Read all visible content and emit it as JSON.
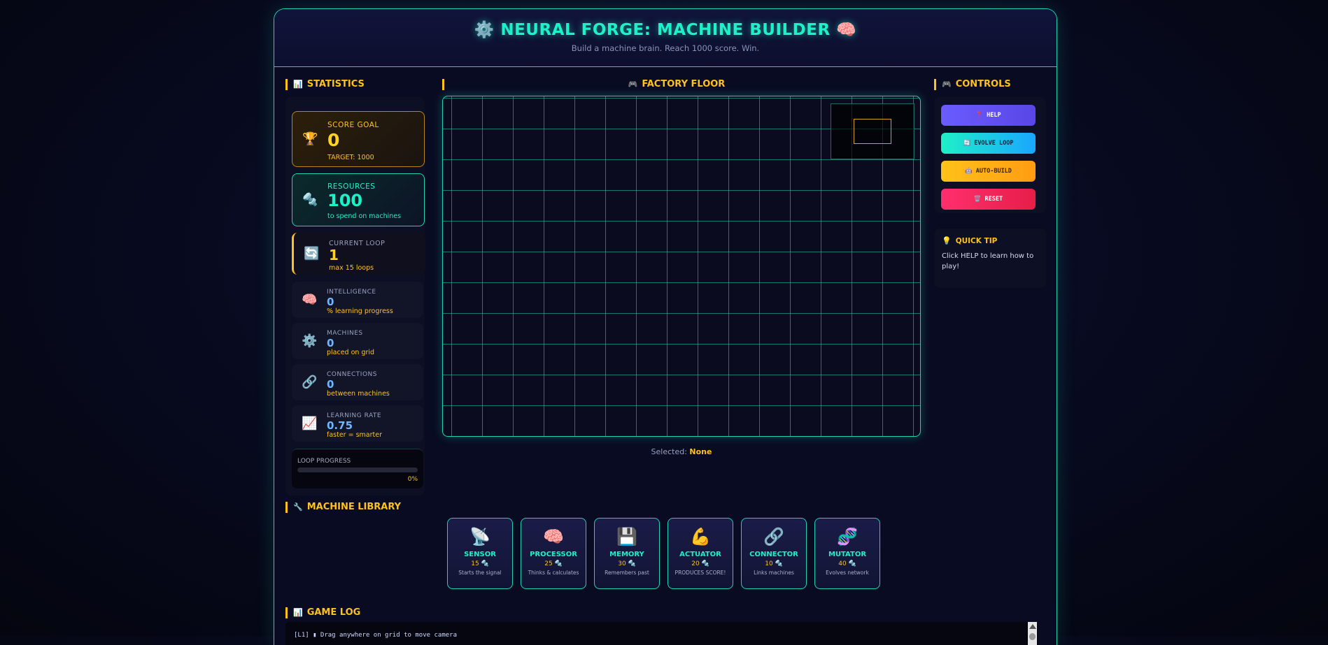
{
  "header": {
    "title": "⚙️ NEURAL FORGE: MACHINE BUILDER 🧠",
    "subtitle": "Build a machine brain. Reach 1000 score. Win."
  },
  "statistics": {
    "title": "STATISTICS",
    "goal": {
      "label": "SCORE GOAL",
      "value": "0",
      "sub": "TARGET: 1000"
    },
    "resources": {
      "label": "RESOURCES",
      "value": "100",
      "sub": "to spend on machines"
    },
    "loop": {
      "label": "CURRENT LOOP",
      "value": "1",
      "sub": "max 15 loops"
    },
    "intelligence": {
      "label": "INTELLIGENCE",
      "value": "0",
      "sub": "% learning progress"
    },
    "machines": {
      "label": "MACHINES",
      "value": "0",
      "sub": "placed on grid"
    },
    "connections": {
      "label": "CONNECTIONS",
      "value": "0",
      "sub": "between machines"
    },
    "learning_rate": {
      "label": "LEARNING RATE",
      "value": "0.75",
      "sub": "faster = smarter"
    },
    "loop_progress": {
      "label": "LOOP PROGRESS",
      "percent_text": "0%",
      "fraction": 0
    }
  },
  "factory": {
    "title": "FACTORY FLOOR",
    "selected_label": "Selected:",
    "selected_value": "None"
  },
  "controls": {
    "title": "CONTROLS",
    "help": "❓ HELP",
    "evolve": "🔄 EVOLVE LOOP",
    "auto_build": "🤖 AUTO-BUILD",
    "reset": "🗑️ RESET"
  },
  "tip": {
    "title": "QUICK TIP",
    "text": "Click HELP to learn how to play!"
  },
  "library": {
    "title": "MACHINE LIBRARY",
    "machines": [
      {
        "icon": "📡",
        "name": "SENSOR",
        "cost": "15 🔩",
        "desc": "Starts the signal"
      },
      {
        "icon": "🧠",
        "name": "PROCESSOR",
        "cost": "25 🔩",
        "desc": "Thinks & calculates"
      },
      {
        "icon": "💾",
        "name": "MEMORY",
        "cost": "30 🔩",
        "desc": "Remembers past"
      },
      {
        "icon": "💪",
        "name": "ACTUATOR",
        "cost": "20 🔩",
        "desc": "PRODUCES SCORE!"
      },
      {
        "icon": "🔗",
        "name": "CONNECTOR",
        "cost": "10 🔩",
        "desc": "Links machines"
      },
      {
        "icon": "🧬",
        "name": "MUTATOR",
        "cost": "40 🔩",
        "desc": "Evolves network"
      }
    ]
  },
  "log": {
    "title": "GAME LOG",
    "first_line": "[L1] ▮ Drag anywhere on grid to move camera"
  },
  "icons": {
    "stats": "bar-chart-icon",
    "factory": "gamepad-icon",
    "controls": "gamepad-icon",
    "library": "wrench-icon",
    "log": "bar-chart-icon",
    "tip": "lightbulb-icon"
  },
  "colors": {
    "accent_teal": "#1ed3b3",
    "accent_gold": "#ffc21a",
    "help": "#6a5cff",
    "evolve": "#1aa6ff",
    "auto": "#ff9c12",
    "reset": "#ff2f6d"
  }
}
